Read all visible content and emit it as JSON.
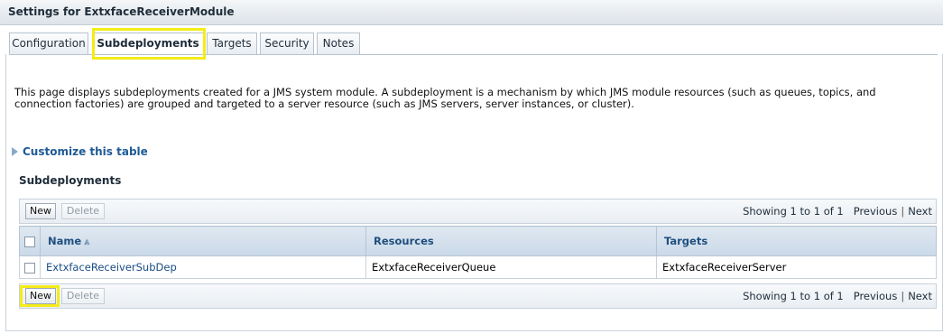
{
  "page": {
    "title": "Settings for ExtxfaceReceiverModule"
  },
  "tabs": [
    {
      "label": "Configuration"
    },
    {
      "label": "Subdeployments"
    },
    {
      "label": "Targets"
    },
    {
      "label": "Security"
    },
    {
      "label": "Notes"
    }
  ],
  "description": "This page displays subdeployments created for a JMS system module. A subdeployment is a mechanism by which JMS module resources (such as queues, topics, and connection factories) are grouped and targeted to a server resource (such as JMS servers, server instances, or cluster).",
  "customize_link": "Customize this table",
  "section_title": "Subdeployments",
  "toolbar": {
    "new_label": "New",
    "delete_label": "Delete",
    "paging_text": "Showing 1 to 1 of 1",
    "previous_label": "Previous",
    "next_label": "Next"
  },
  "table": {
    "columns": [
      "Name",
      "Resources",
      "Targets"
    ],
    "rows": [
      {
        "name": "ExtxfaceReceiverSubDep",
        "resources": "ExtxfaceReceiverQueue",
        "targets": "ExtxfaceReceiverServer"
      }
    ]
  },
  "highlight_color": "#f4ec18"
}
